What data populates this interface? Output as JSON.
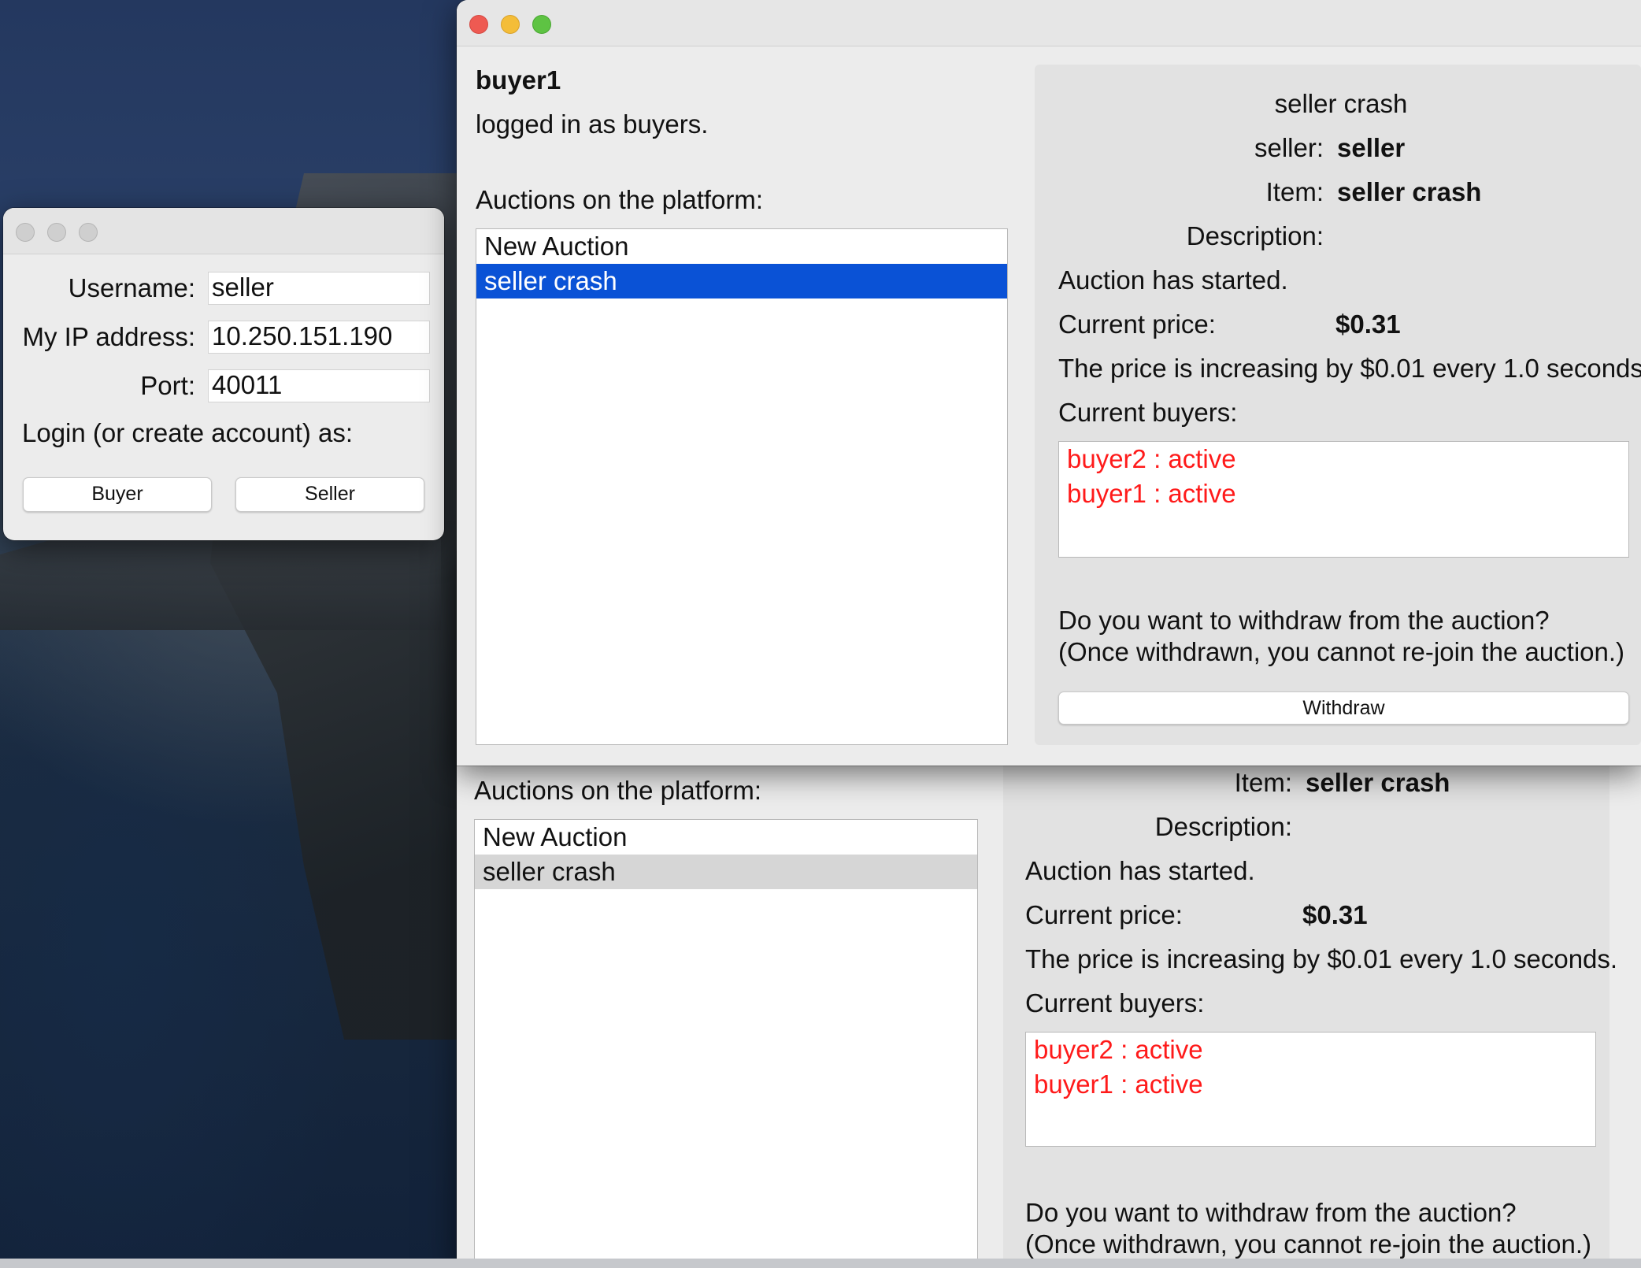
{
  "login_window": {
    "username_label": "Username:",
    "username_value": "seller",
    "ip_label": "My IP address:",
    "ip_value": "10.250.151.190",
    "port_label": "Port:",
    "port_value": "40011",
    "login_prompt": "Login (or create account) as:",
    "buyer_button": "Buyer",
    "seller_button": "Seller"
  },
  "buyer_window": {
    "username": "buyer1",
    "status": "logged in as buyers.",
    "auctions_label": "Auctions on the platform:",
    "auctions": [
      "New Auction",
      "seller crash"
    ],
    "selected_auction": "seller crash",
    "detail": {
      "title": "seller crash",
      "seller_label": "seller:",
      "seller_value": "seller",
      "item_label": "Item:",
      "item_value": "seller crash",
      "description_label": "Description:",
      "auction_status": "Auction has started.",
      "price_label": "Current price:",
      "price_value": "$0.31",
      "increase_text": "The price is increasing by $0.01 every 1.0 seconds.",
      "buyers_label": "Current buyers:",
      "buyers": [
        "buyer2 : active",
        "buyer1 : active"
      ],
      "withdraw_question": "Do you want to withdraw from the auction?",
      "withdraw_note": "(Once withdrawn, you cannot re-join the auction.)",
      "withdraw_button": "Withdraw"
    }
  },
  "background_window": {
    "auctions_label": "Auctions on the platform:",
    "auctions": [
      "New Auction",
      "seller crash"
    ],
    "detail": {
      "item_label": "Item:",
      "item_value": "seller crash",
      "description_label": "Description:",
      "auction_status": "Auction has started.",
      "price_label": "Current price:",
      "price_value": "$0.31",
      "increase_text": "The price is increasing by $0.01 every 1.0 seconds.",
      "buyers_label": "Current buyers:",
      "buyers": [
        "buyer2 : active",
        "buyer1 : active"
      ],
      "withdraw_question": "Do you want to withdraw from the auction?",
      "withdraw_note": "(Once withdrawn, you cannot re-join the auction.)"
    }
  },
  "colors": {
    "selection": "#0a52d6",
    "buyer_status": "#ff1a1a",
    "close": "#ee5a52",
    "minimize": "#f4bd38",
    "zoom": "#5ec343"
  }
}
